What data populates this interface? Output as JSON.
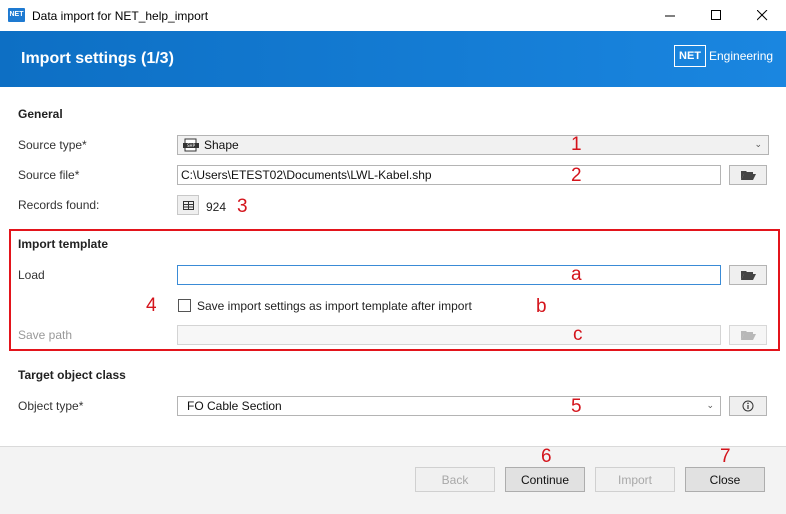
{
  "window": {
    "app_icon_text": "NET",
    "title": "Data import for NET_help_import"
  },
  "header": {
    "title": "Import settings (1/3)",
    "logo_box": "NET",
    "logo_text": "Engineering"
  },
  "general": {
    "section_title": "General",
    "source_type_label": "Source type*",
    "source_type_value": "Shape",
    "source_file_label": "Source file*",
    "source_file_value": "C:\\Users\\ETEST02\\Documents\\LWL-Kabel.shp",
    "records_label": "Records found:",
    "records_value": "924"
  },
  "import_template": {
    "section_title": "Import template",
    "load_label": "Load",
    "load_value": "",
    "checkbox_label": "Save import settings as import template after import",
    "checkbox_checked": false,
    "save_path_label": "Save path",
    "save_path_value": ""
  },
  "target": {
    "section_title": "Target object class",
    "object_type_label": "Object type*",
    "object_type_value": "FO Cable Section"
  },
  "footer": {
    "back": "Back",
    "continue": "Continue",
    "import": "Import",
    "close": "Close"
  },
  "annotations": {
    "n1": "1",
    "n2": "2",
    "n3": "3",
    "n4": "4",
    "na": "a",
    "nb": "b",
    "nc": "c",
    "n5": "5",
    "n6": "6",
    "n7": "7"
  },
  "colors": {
    "header_blue": "#1a86e0",
    "annotation_red": "#e3141b"
  }
}
